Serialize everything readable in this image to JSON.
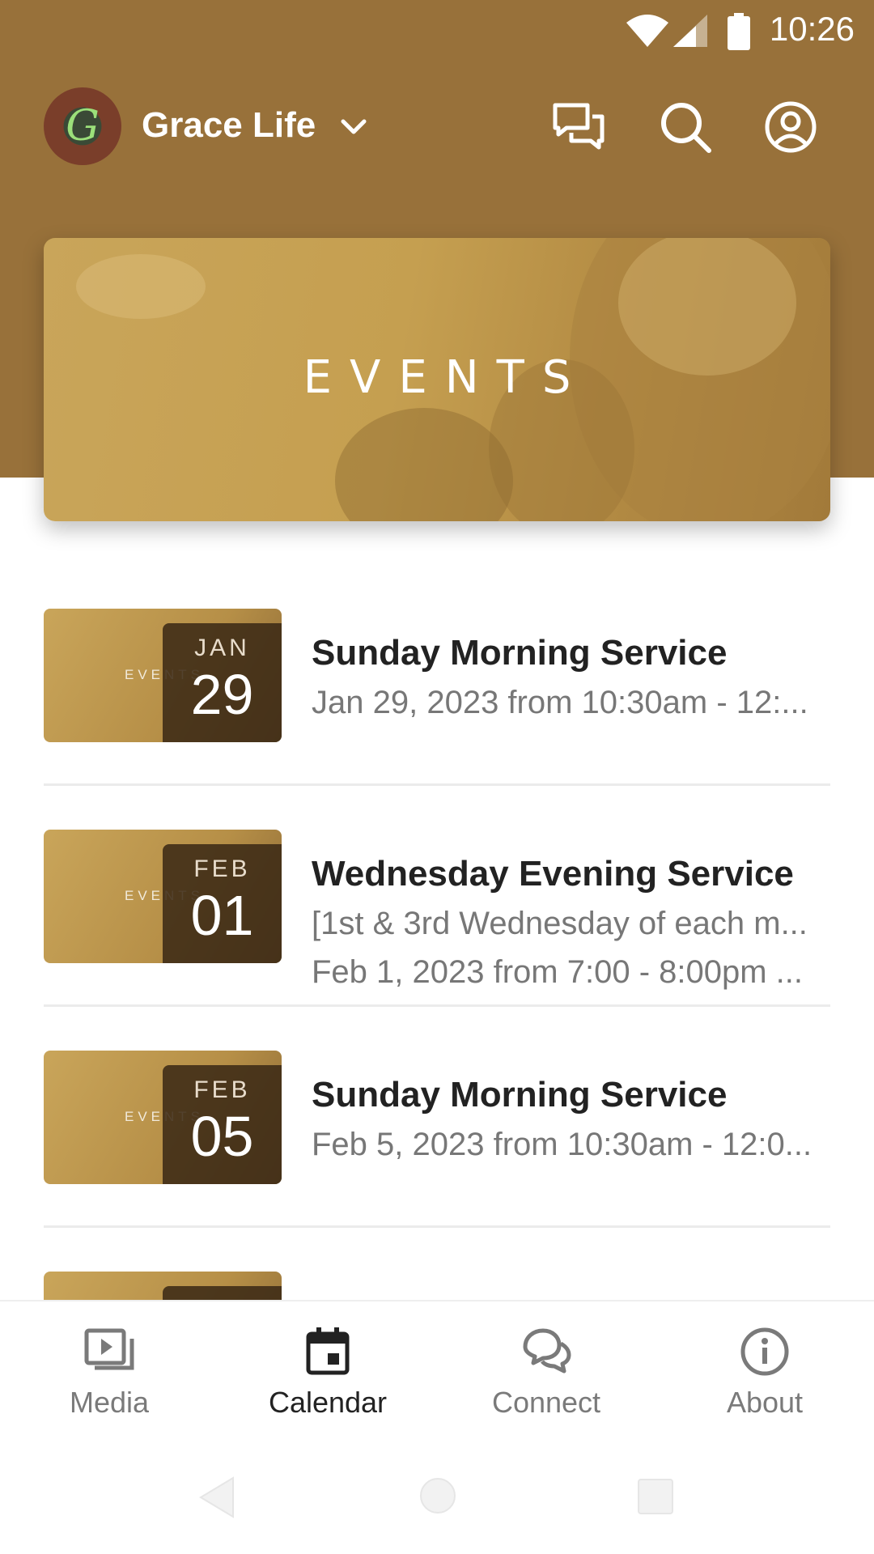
{
  "status_bar": {
    "time": "10:26"
  },
  "app_bar": {
    "org_initial": "G",
    "title": "Grace Life"
  },
  "hero": {
    "title": "EVENTS"
  },
  "thumbnail_label": "EVENTS",
  "events": [
    {
      "month": "JAN",
      "day": "29",
      "title": "Sunday Morning Service",
      "lines": [
        "Jan 29, 2023 from 10:30am - 12:..."
      ]
    },
    {
      "month": "FEB",
      "day": "01",
      "title": "Wednesday Evening Service",
      "lines": [
        "[1st & 3rd Wednesday of each m...",
        "Feb 1, 2023 from 7:00 - 8:00pm ..."
      ]
    },
    {
      "month": "FEB",
      "day": "05",
      "title": "Sunday Morning Service",
      "lines": [
        "Feb 5, 2023 from 10:30am - 12:0..."
      ]
    }
  ],
  "bottom_nav": {
    "items": [
      {
        "label": "Media",
        "icon": "media-icon",
        "active": false
      },
      {
        "label": "Calendar",
        "icon": "calendar-icon",
        "active": true
      },
      {
        "label": "Connect",
        "icon": "chat-bubbles-icon",
        "active": false
      },
      {
        "label": "About",
        "icon": "info-icon",
        "active": false
      }
    ]
  },
  "colors": {
    "header": "#98713a",
    "hero_tint": "#c59f50",
    "date_box": "#3c2a16",
    "text_primary": "#222222",
    "text_secondary": "#777777"
  }
}
